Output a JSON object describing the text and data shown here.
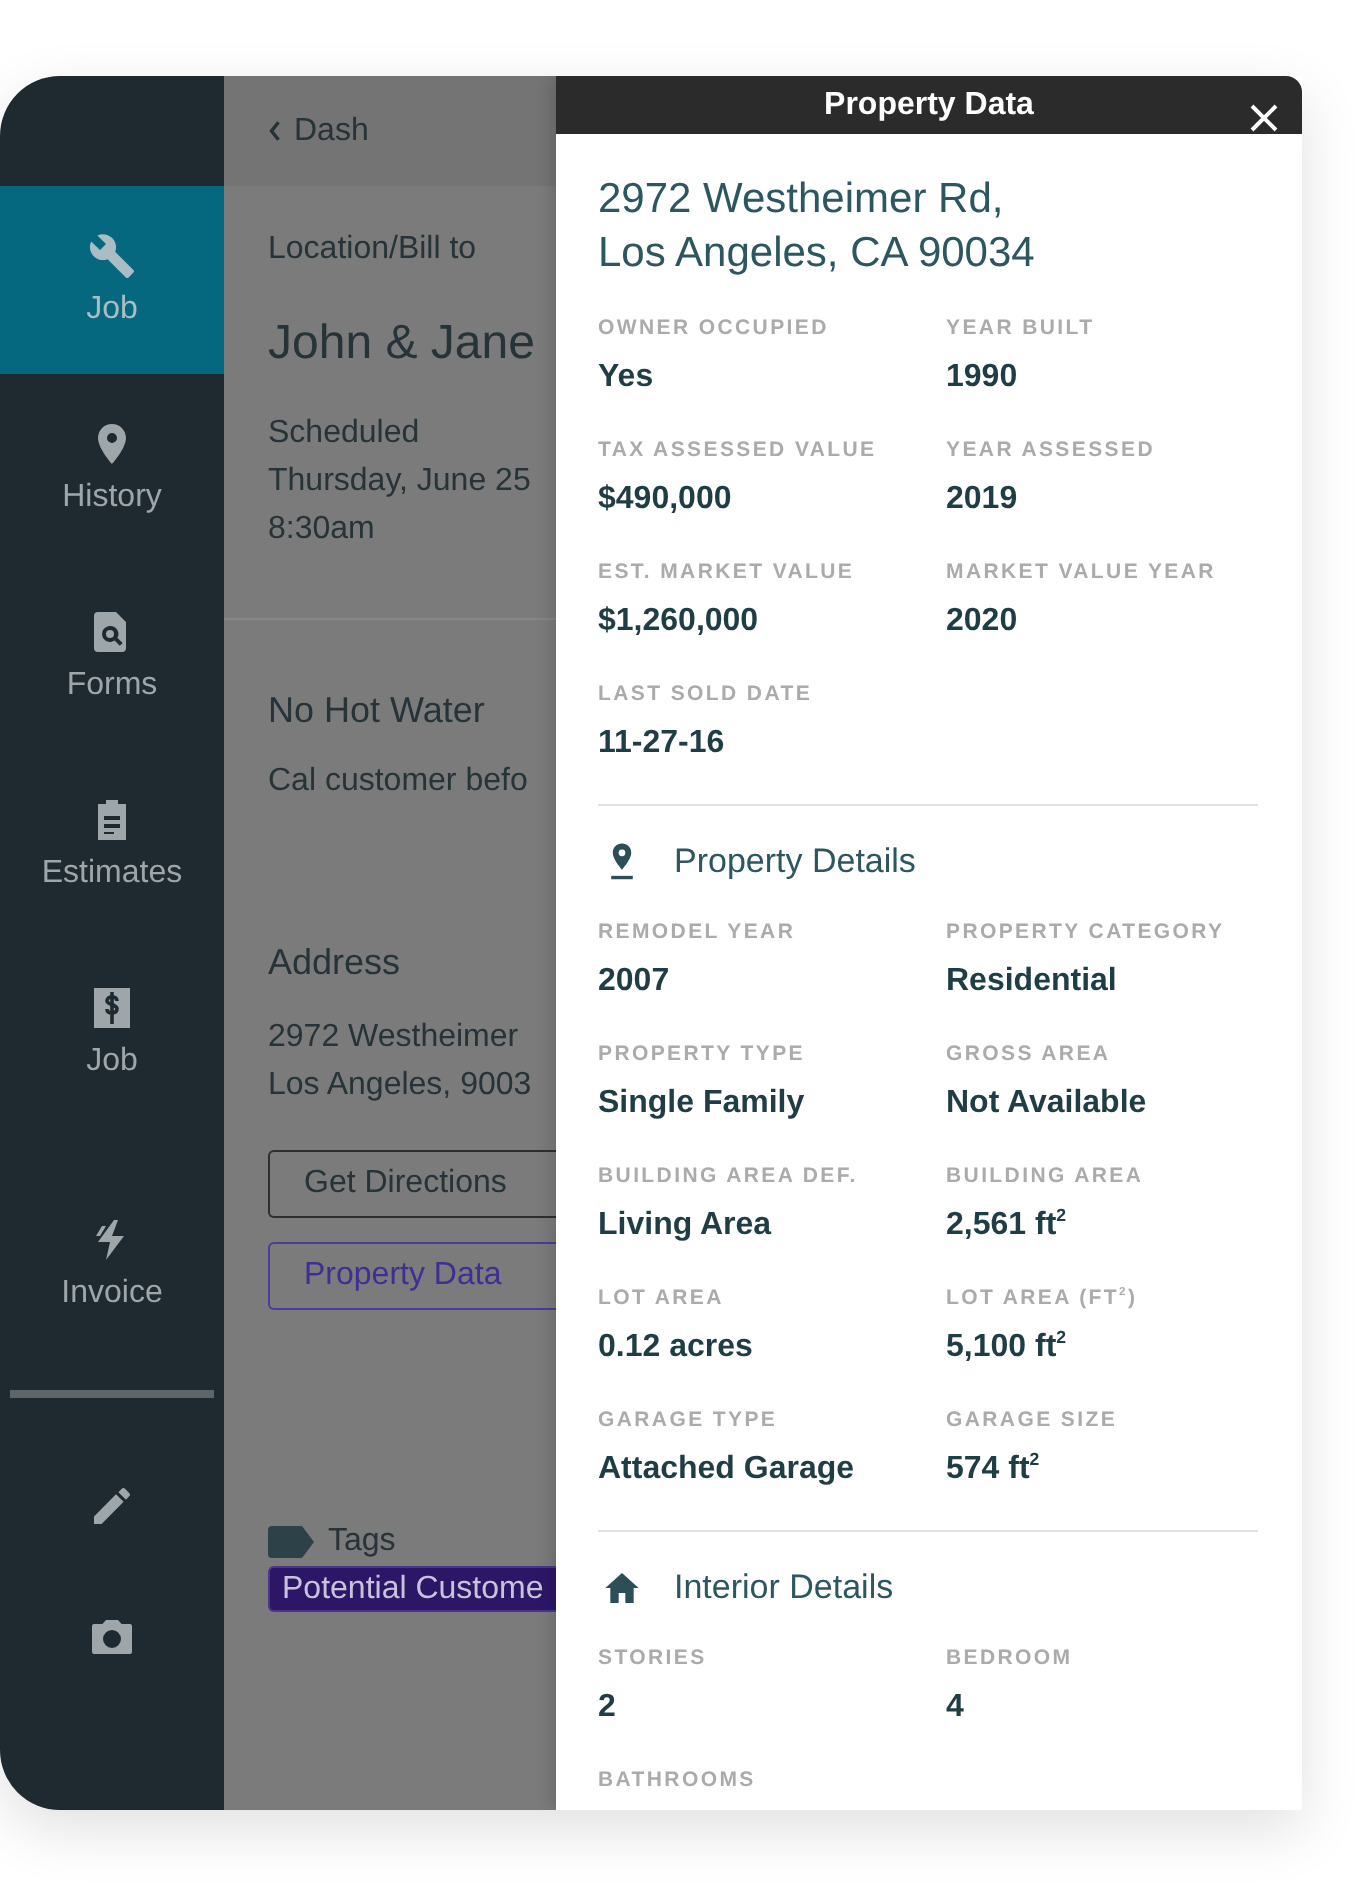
{
  "sidebar": {
    "items": [
      {
        "label": "Job",
        "selected": true
      },
      {
        "label": "History",
        "selected": false
      },
      {
        "label": "Forms",
        "selected": false
      },
      {
        "label": "Estimates",
        "selected": false
      },
      {
        "label": "Job",
        "selected": false
      },
      {
        "label": "Invoice",
        "selected": false
      }
    ],
    "tools": [
      {
        "kind": "pencil"
      },
      {
        "kind": "camera"
      }
    ]
  },
  "job_panel": {
    "back": "Dash",
    "bill_to_label": "Location/Bill to",
    "customer": "John & Jane",
    "scheduled_label": "Scheduled",
    "scheduled_date": "Thursday, June 25",
    "scheduled_time": "8:30am",
    "job_title": "No Hot Water",
    "job_note": "Cal customer befo",
    "address_label": "Address",
    "address_lines": [
      "2972 Westheimer",
      "Los Angeles, 9003"
    ],
    "buttons": [
      {
        "label": "Get Directions",
        "kind": "plain"
      },
      {
        "label": "Property Data",
        "kind": "accent"
      }
    ],
    "tags_label": "Tags",
    "tags": [
      "Potential Custome"
    ]
  },
  "property_panel": {
    "title": "Property Data",
    "address": [
      "2972 Westheimer Rd,",
      "Los Angeles, CA 90034"
    ],
    "fields": [
      {
        "label": "OWNER OCCUPIED",
        "value": "Yes"
      },
      {
        "label": "YEAR BUILT",
        "value": "1990"
      },
      {
        "label": "TAX ASSESSED VALUE",
        "value": "$490,000"
      },
      {
        "label": "YEAR ASSESSED",
        "value": "2019"
      },
      {
        "label": "EST. MARKET VALUE",
        "value": "$1,260,000"
      },
      {
        "label": "MARKET VALUE YEAR",
        "value": "2020"
      },
      {
        "label": "LAST SOLD DATE",
        "value": "11-27-16"
      }
    ],
    "sections": [
      {
        "title": "Property Details",
        "kind": "pin",
        "fields": [
          {
            "label": "REMODEL YEAR",
            "value": "2007"
          },
          {
            "label": "PROPERTY CATEGORY",
            "value": "Residential"
          },
          {
            "label": "PROPERTY TYPE",
            "value": "Single Family"
          },
          {
            "label": "GROSS AREA",
            "value": "Not Available"
          },
          {
            "label": "BUILDING AREA DEF.",
            "value": "Living Area"
          },
          {
            "label": "BUILDING AREA",
            "value": "2,561 ft$^{2}$"
          },
          {
            "label": "LOT AREA",
            "value": "0.12 acres"
          },
          {
            "label": "LOT AREA (FT$^{2}$)",
            "value": "5,100 ft$^{2}$"
          },
          {
            "label": "GARAGE TYPE",
            "value": "Attached Garage"
          },
          {
            "label": "GARAGE SIZE",
            "value": "574 ft$^{2}$"
          }
        ]
      },
      {
        "title": "Interior Details",
        "kind": "house",
        "fields": [
          {
            "label": "STORIES",
            "value": "2"
          },
          {
            "label": "BEDROOM",
            "value": "4"
          },
          {
            "label": "BATHROOMS"
          }
        ]
      }
    ]
  }
}
